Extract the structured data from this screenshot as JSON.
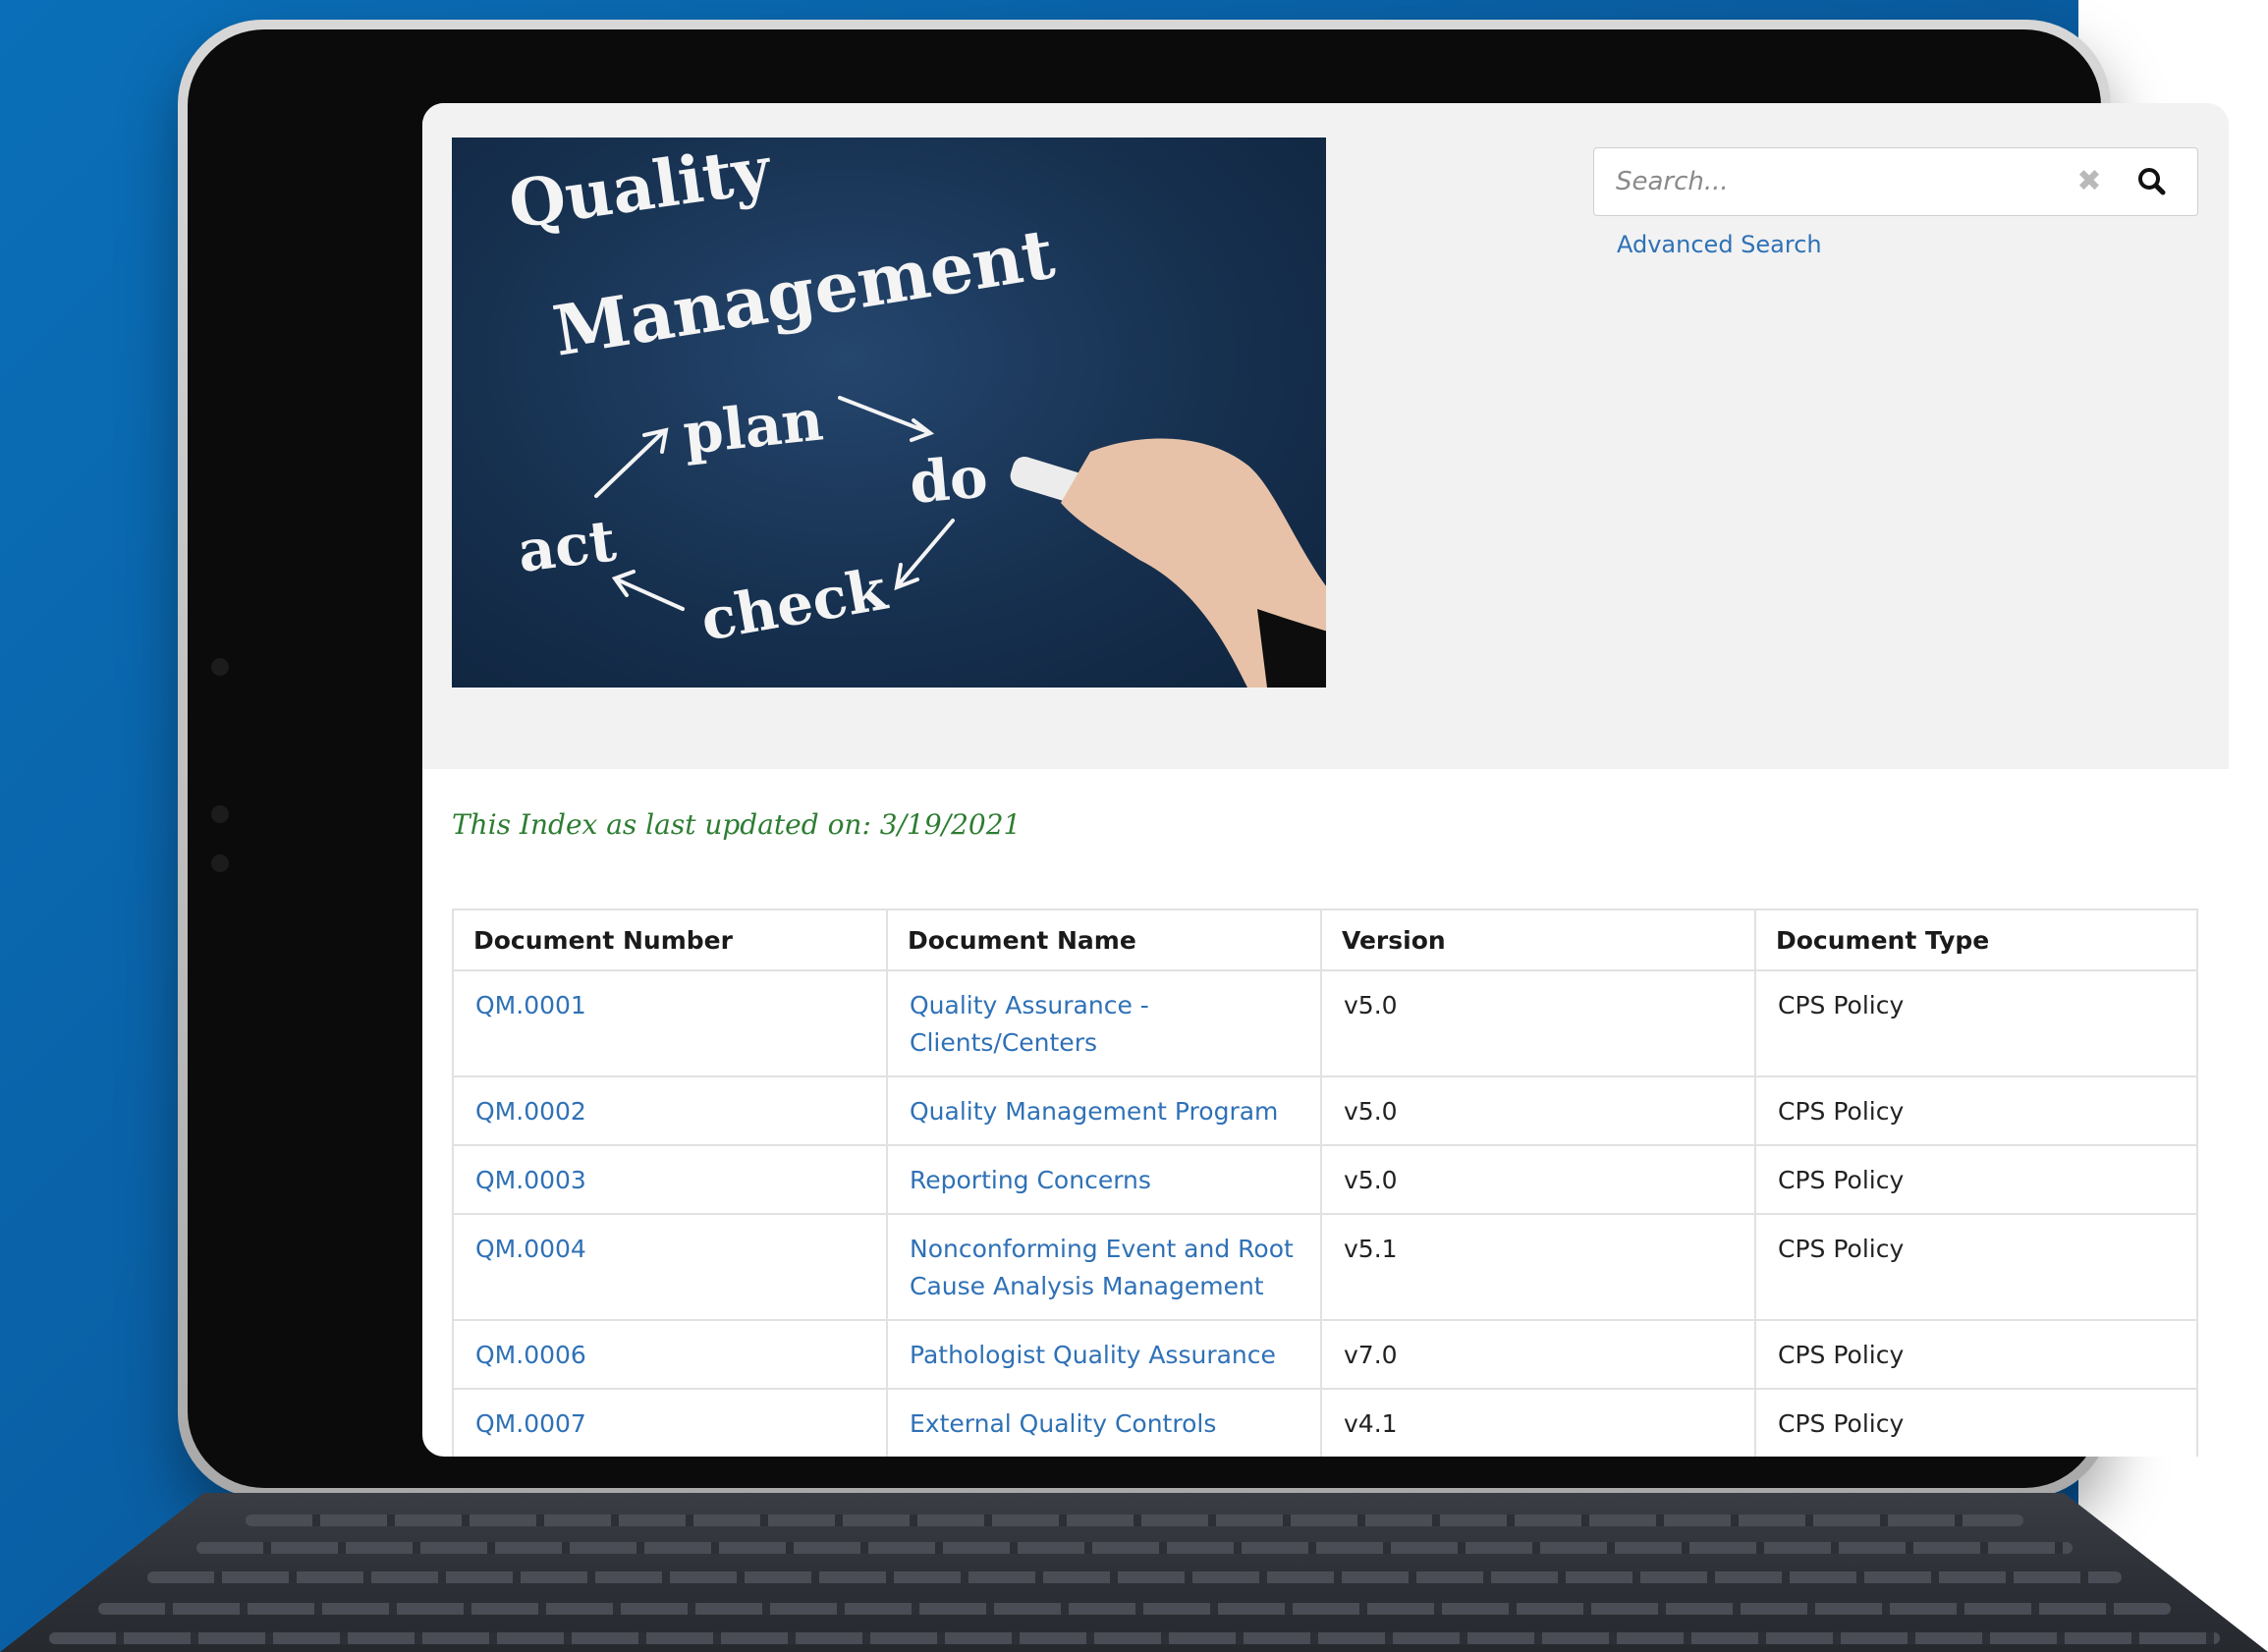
{
  "hero_image": {
    "words": [
      "Quality",
      "Management",
      "plan",
      "do",
      "check",
      "act"
    ]
  },
  "search": {
    "placeholder": "Search...",
    "clear_icon": "close-icon",
    "search_icon": "magnifier-icon"
  },
  "advanced_search_label": "Advanced Search",
  "updated_text": "This Index as last updated on: 3/19/2021",
  "table": {
    "headers": [
      "Document Number",
      "Document Name",
      "Version",
      "Document Type"
    ],
    "rows": [
      {
        "number": "QM.0001",
        "name": "Quality Assurance - Clients/Centers",
        "version": "v5.0",
        "type": "CPS Policy"
      },
      {
        "number": "QM.0002",
        "name": "Quality Management Program",
        "version": "v5.0",
        "type": "CPS Policy"
      },
      {
        "number": "QM.0003",
        "name": "Reporting Concerns",
        "version": "v5.0",
        "type": "CPS Policy"
      },
      {
        "number": "QM.0004",
        "name": "Nonconforming Event and Root Cause Analysis Management",
        "version": "v5.1",
        "type": "CPS Policy"
      },
      {
        "number": "QM.0006",
        "name": "Pathologist Quality Assurance",
        "version": "v7.0",
        "type": "CPS Policy"
      },
      {
        "number": "QM.0007",
        "name": "External Quality Controls",
        "version": "v4.1",
        "type": "CPS Policy"
      }
    ]
  },
  "colors": {
    "background_blue": "#0a5fa4",
    "link": "#2f71b6",
    "updated_text": "#2e7d32"
  }
}
